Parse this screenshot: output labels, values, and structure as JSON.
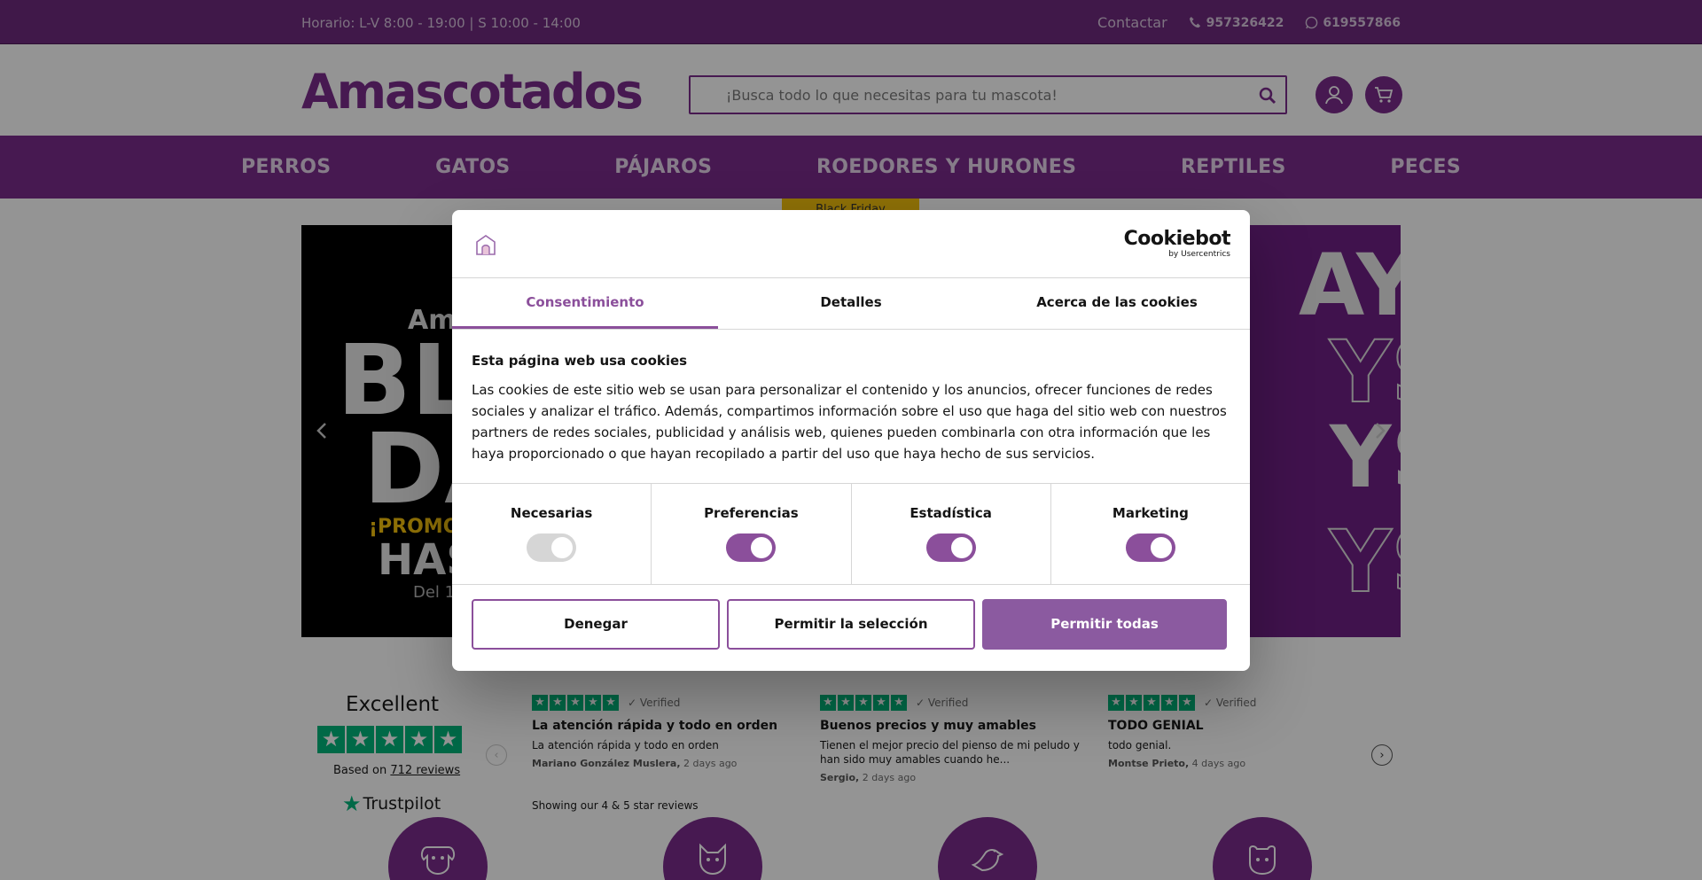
{
  "topbar": {
    "hours": "Horario: L-V 8:00 - 19:00 | S 10:00 - 14:00",
    "contact": "Contactar",
    "phone": "957326422",
    "whatsapp": "619557866"
  },
  "header": {
    "logo": "Amascotados",
    "search_placeholder": "¡Busca todo lo que necesitas para tu mascota!"
  },
  "nav": {
    "items": [
      "PERROS",
      "GATOS",
      "PÁJAROS",
      "ROEDORES Y HURONES",
      "REPTILES",
      "PECES"
    ]
  },
  "promo_tag": "Black Friday",
  "hero": {
    "line1": "Am",
    "line2": "BL",
    "line3": "DA",
    "line4": "¡PROMO",
    "line5": "HAS",
    "line6": "Del 1",
    "right_text": [
      "AYS",
      "YS",
      "YS",
      "YS"
    ]
  },
  "trustpilot": {
    "rating_word": "Excellent",
    "based_on": "Based on",
    "reviews_count": "712 reviews",
    "brand": "Trustpilot",
    "showing": "Showing our 4 & 5 star reviews",
    "verified": "Verified",
    "reviews": [
      {
        "title": "La atención rápida y todo en orden",
        "body": "La atención rápida y todo en orden",
        "author": "Mariano González Muslera,",
        "when": "2 days ago"
      },
      {
        "title": "Buenos precios y muy amables",
        "body": "Tienen el mejor precio del pienso de mi peludo y han sido muy amables cuando he...",
        "author": "Sergio,",
        "when": "2 days ago"
      },
      {
        "title": "TODO GENIAL",
        "body": "todo genial.",
        "author": "Montse Prieto,",
        "when": "4 days ago"
      }
    ]
  },
  "cookie_dialog": {
    "brand": "Cookiebot",
    "brand_sub": "by Usercentrics",
    "tabs": [
      "Consentimiento",
      "Detalles",
      "Acerca de las cookies"
    ],
    "heading": "Esta página web usa cookies",
    "text": "Las cookies de este sitio web se usan para personalizar el contenido y los anuncios, ofrecer funciones de redes sociales y analizar el tráfico. Además, compartimos información sobre el uso que haga del sitio web con nuestros partners de redes sociales, publicidad y análisis web, quienes pueden combinarla con otra información que les haya proporcionado o que hayan recopilado a partir del uso que haya hecho de sus servicios.",
    "toggles": [
      {
        "label": "Necesarias",
        "on": true,
        "disabled": true
      },
      {
        "label": "Preferencias",
        "on": true
      },
      {
        "label": "Estadística",
        "on": true
      },
      {
        "label": "Marketing",
        "on": true
      }
    ],
    "buttons": {
      "deny": "Denegar",
      "allow_selection": "Permitir la selección",
      "allow_all": "Permitir todas"
    }
  },
  "colors": {
    "brand": "#7a2b8c",
    "accent": "#8b4f9b",
    "trustpilot_green": "#00b67a"
  }
}
